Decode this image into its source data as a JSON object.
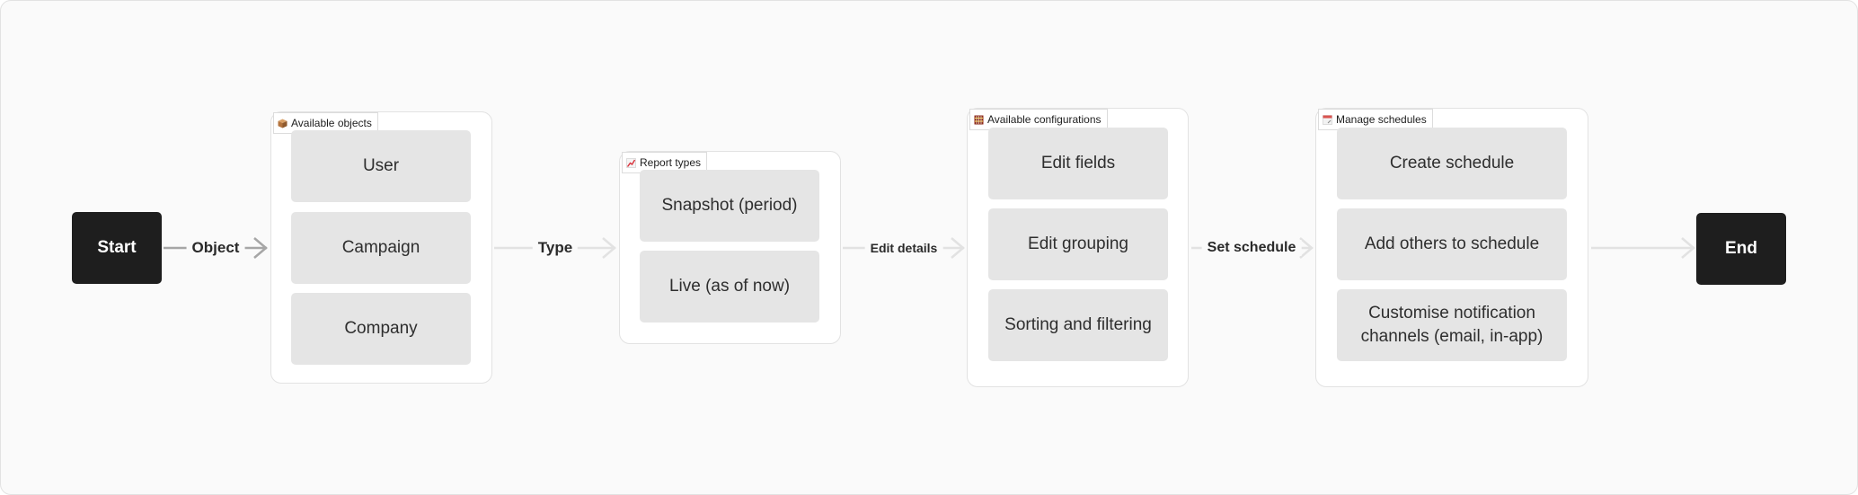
{
  "diagram": {
    "start": {
      "label": "Start"
    },
    "end": {
      "label": "End"
    },
    "edges": [
      {
        "label": "Object",
        "color": "#a6a6a6"
      },
      {
        "label": "Type",
        "color": "#e2e2e2"
      },
      {
        "label": "Edit details",
        "color": "#e2e2e2"
      },
      {
        "label": "Set schedule",
        "color": "#e2e2e2"
      },
      {
        "label": "",
        "color": "#e2e2e2"
      }
    ],
    "groups": [
      {
        "title": "Available objects",
        "icon": "package-icon",
        "items": [
          "User",
          "Campaign",
          "Company"
        ]
      },
      {
        "title": "Report types",
        "icon": "chart-increasing-icon",
        "items": [
          "Snapshot (period)",
          "Live (as of now)"
        ]
      },
      {
        "title": "Available configurations",
        "icon": "abacus-icon",
        "items": [
          "Edit fields",
          "Edit grouping",
          "Sorting and filtering"
        ]
      },
      {
        "title": "Manage schedules",
        "icon": "calendar-icon",
        "items": [
          "Create schedule",
          "Add others to schedule",
          "Customise notification channels (email, in-app)"
        ]
      }
    ]
  }
}
